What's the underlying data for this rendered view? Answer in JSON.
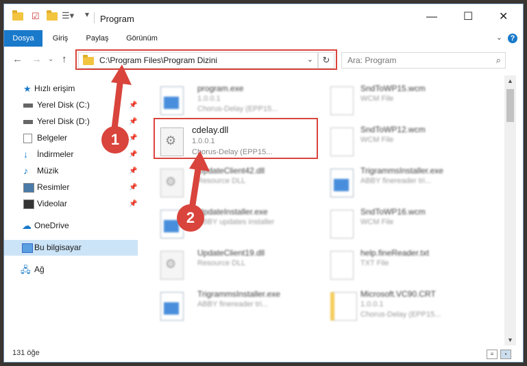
{
  "window": {
    "title": "Program"
  },
  "ribbon": {
    "tabs": [
      "Dosya",
      "Giriş",
      "Paylaş",
      "Görünüm"
    ],
    "active": 0
  },
  "address": {
    "path": "C:\\Program Files\\Program Dizini"
  },
  "search": {
    "placeholder": "Ara: Program"
  },
  "sidebar": {
    "items": [
      {
        "label": "Hızlı erişim",
        "icon": "star-icon",
        "pinned": false
      },
      {
        "label": "Yerel Disk (C:)",
        "icon": "drive-icon",
        "pinned": true
      },
      {
        "label": "Yerel Disk (D:)",
        "icon": "drive-icon",
        "pinned": true
      },
      {
        "label": "Belgeler",
        "icon": "documents-icon",
        "pinned": true
      },
      {
        "label": "İndirmeler",
        "icon": "download-icon",
        "pinned": true
      },
      {
        "label": "Müzik",
        "icon": "music-icon",
        "pinned": true
      },
      {
        "label": "Resimler",
        "icon": "pictures-icon",
        "pinned": true
      },
      {
        "label": "Videolar",
        "icon": "videos-icon",
        "pinned": true
      },
      {
        "label": "OneDrive",
        "icon": "cloud-icon",
        "pinned": false
      },
      {
        "label": "Bu bilgisayar",
        "icon": "computer-icon",
        "pinned": false,
        "selected": true
      },
      {
        "label": "Ağ",
        "icon": "network-icon",
        "pinned": false
      }
    ]
  },
  "files": [
    {
      "name": "program.exe",
      "line1": "1.0.0.1",
      "line2": "Chorus-Delay (EPP15...",
      "type": "exe",
      "blurred": true
    },
    {
      "name": "SndToWP15.wcm",
      "line1": "WCM File",
      "line2": "",
      "type": "doc",
      "blurred": true
    },
    {
      "name": "cdelay.dll",
      "line1": "1.0.0.1",
      "line2": "Chorus-Delay (EPP15...",
      "type": "dll",
      "blurred": false
    },
    {
      "name": "SndToWP12.wcm",
      "line1": "WCM File",
      "line2": "",
      "type": "doc",
      "blurred": true
    },
    {
      "name": "UpdateClient42.dll",
      "line1": "Resource DLL",
      "line2": "",
      "type": "dll",
      "blurred": true
    },
    {
      "name": "TrigrammsInstaller.exe",
      "line1": "ABBY finereader tri...",
      "line2": "",
      "type": "exe",
      "blurred": true
    },
    {
      "name": "UpdateInstaller.exe",
      "line1": "ABBY updates installer",
      "line2": "",
      "type": "exe",
      "blurred": true
    },
    {
      "name": "SndToWP16.wcm",
      "line1": "WCM File",
      "line2": "",
      "type": "doc",
      "blurred": true
    },
    {
      "name": "UpdateClient19.dll",
      "line1": "Resource DLL",
      "line2": "",
      "type": "dll",
      "blurred": true
    },
    {
      "name": "help.fineReader.txt",
      "line1": "TXT File",
      "line2": "",
      "type": "doc",
      "blurred": true
    },
    {
      "name": "TrigrammsInstaller.exe",
      "line1": "ABBY finereader tri...",
      "line2": "",
      "type": "exe",
      "blurred": true
    },
    {
      "name": "Microsoft.VC90.CRT",
      "line1": "1.0.0.1",
      "line2": "Chorus-Delay (EPP15...",
      "type": "doc",
      "blurred": true
    }
  ],
  "status": {
    "count": "131 öğe"
  },
  "annotations": {
    "badge1": "1",
    "badge2": "2",
    "color": "#d9443c"
  }
}
